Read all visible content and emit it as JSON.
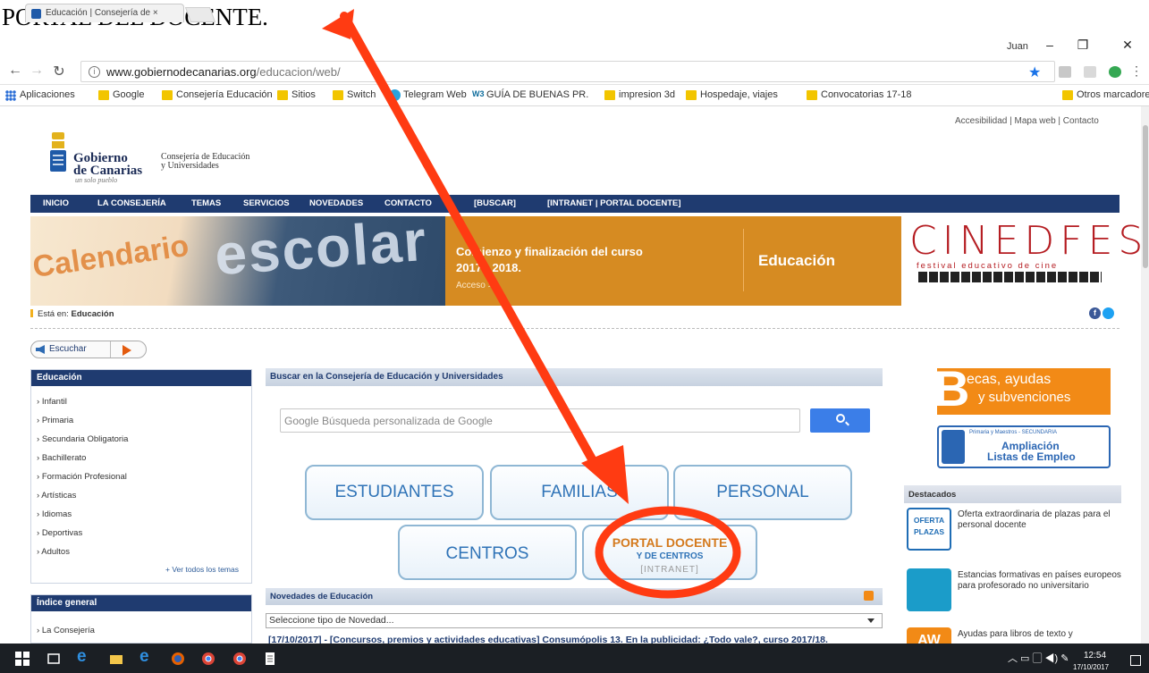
{
  "caption": "PORTAL DEL DOCENTE.",
  "browser": {
    "tab_title": "Educación | Consejería de ×",
    "user": "Juan",
    "address_host": "www.gobiernodecanarias.org",
    "address_path": "/educacion/web/",
    "bookmarks": [
      "Aplicaciones",
      "Google",
      "Consejería Educación",
      "Sitios",
      "Switch",
      "Telegram Web",
      "GUÍA DE BUENAS PR.",
      "impresion 3d",
      "Hospedaje, viajes",
      "Convocatorias 17-18"
    ],
    "other_bookmarks": "Otros marcadores"
  },
  "site": {
    "top_links": "Accesibilidad   |   Mapa web   |   Contacto",
    "logo": {
      "line1": "Gobierno",
      "line2": "de Canarias",
      "tagline": "un solo pueblo",
      "dept1": "Consejería de Educación",
      "dept2": "y Universidades"
    },
    "nav": [
      "INICIO",
      "LA CONSEJERÍA",
      "TEMAS",
      "SERVICIOS",
      "NOVEDADES",
      "CONTACTO",
      "[BUSCAR]",
      "[INTRANET | PORTAL DOCENTE]"
    ],
    "banner": {
      "cal_word": "Calendario",
      "esc_word": "escolar",
      "line1": "Comienzo y finalización del curso",
      "line2": "2017 - 2018.",
      "line3": "Acceso >>",
      "section": "Educación"
    },
    "cinedfest": {
      "title": "CINEDFEST",
      "subtitle": "festival educativo de cine"
    },
    "breadcrumb": {
      "prefix": "Está en:",
      "current": "Educación"
    },
    "listen_label": "Escuchar",
    "left_menu": {
      "title": "Educación",
      "items": [
        "Infantil",
        "Primaria",
        "Secundaria Obligatoria",
        "Bachillerato",
        "Formación Profesional",
        "Artísticas",
        "Idiomas",
        "Deportivas",
        "Adultos"
      ],
      "more": "+ Ver todos los temas"
    },
    "index_menu": {
      "title": "Índice general",
      "items": [
        "La Consejería"
      ]
    },
    "search": {
      "header": "Buscar en la Consejería de Educación y Universidades",
      "placeholder": "Google Búsqueda personalizada de Google"
    },
    "portal_buttons": {
      "estudiantes": "ESTUDIANTES",
      "familias": "FAMILIAS",
      "personal": "PERSONAL",
      "centros": "CENTROS",
      "docente_line1": "PORTAL DOCENTE",
      "docente_line2": "Y DE CENTROS",
      "docente_line3": "[INTRANET]"
    },
    "news": {
      "header": "Novedades de Educación",
      "select": "Seleccione tipo de Novedad...",
      "first_item": "[17/10/2017] - [Concursos, premios y actividades educativas] Consumópolis 13. En la publicidad: ¿Todo vale?, curso 2017/18."
    },
    "becas": {
      "b": "B",
      "line1": "ecas, ayudas",
      "line2": "y subvenciones"
    },
    "ampliacion": {
      "small": "Primaria y Maestros - SECUNDARIA",
      "line1": "Ampliación",
      "line2": "Listas de Empleo"
    },
    "destacados": {
      "title": "Destacados",
      "items": [
        {
          "icon_top": "OFERTA",
          "icon_bottom": "PLAZAS",
          "text": "Oferta extraordinaria de plazas para el personal docente"
        },
        {
          "text": "Estancias formativas en países europeos para profesorado no universitario"
        },
        {
          "icon": "AW",
          "text": "Ayudas para libros de texto y"
        }
      ]
    }
  },
  "taskbar": {
    "time": "12:54",
    "date": "17/10/2017"
  },
  "colors": {
    "nav": "#1f3b70",
    "banner_orange": "#d68b22",
    "arrow_red": "#ff3b12",
    "portal_orange": "#d47a1e",
    "portal_blue": "#2f73b7"
  }
}
